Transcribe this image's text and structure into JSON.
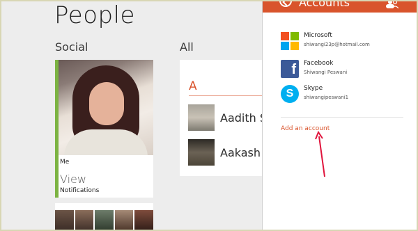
{
  "page": {
    "title": "People"
  },
  "sections": {
    "social": "Social",
    "all": "All"
  },
  "me_card": {
    "label": "Me",
    "view": "View",
    "notifications": "Notifications"
  },
  "all_list": {
    "letter": "A",
    "contacts": [
      {
        "name": "Aadith S"
      },
      {
        "name": "Aakash C"
      }
    ]
  },
  "accounts": {
    "title": "Accounts",
    "items": [
      {
        "name": "Microsoft",
        "id": "shiwangi23p@hotmail.com",
        "icon": "microsoft-icon"
      },
      {
        "name": "Facebook",
        "id": "Shiwangi Peswani",
        "icon": "facebook-icon"
      },
      {
        "name": "Skype",
        "id": "shiwangipeswani1",
        "icon": "skype-icon"
      }
    ],
    "add_label": "Add an account"
  },
  "icons": {
    "facebook_glyph": "f",
    "skype_glyph": "S"
  },
  "colors": {
    "accent": "#d9542c",
    "me_border": "#7cb342",
    "ms_red": "#f25022",
    "ms_green": "#7fba00",
    "ms_blue": "#00a4ef",
    "ms_yellow": "#ffb900",
    "facebook": "#3b5998",
    "skype": "#00aff0",
    "annotation_arrow": "#e0143c"
  }
}
